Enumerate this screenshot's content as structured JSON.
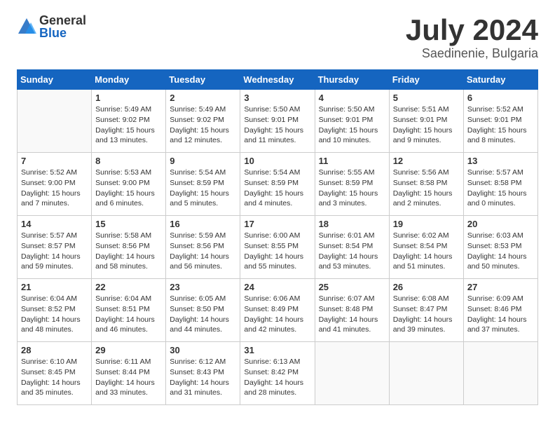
{
  "header": {
    "logo_general": "General",
    "logo_blue": "Blue",
    "month_year": "July 2024",
    "location": "Saedinenie, Bulgaria"
  },
  "days_of_week": [
    "Sunday",
    "Monday",
    "Tuesday",
    "Wednesday",
    "Thursday",
    "Friday",
    "Saturday"
  ],
  "weeks": [
    [
      {
        "day": "",
        "empty": true
      },
      {
        "day": "1",
        "sunrise": "5:49 AM",
        "sunset": "9:02 PM",
        "daylight": "15 hours and 13 minutes."
      },
      {
        "day": "2",
        "sunrise": "5:49 AM",
        "sunset": "9:02 PM",
        "daylight": "15 hours and 12 minutes."
      },
      {
        "day": "3",
        "sunrise": "5:50 AM",
        "sunset": "9:01 PM",
        "daylight": "15 hours and 11 minutes."
      },
      {
        "day": "4",
        "sunrise": "5:50 AM",
        "sunset": "9:01 PM",
        "daylight": "15 hours and 10 minutes."
      },
      {
        "day": "5",
        "sunrise": "5:51 AM",
        "sunset": "9:01 PM",
        "daylight": "15 hours and 9 minutes."
      },
      {
        "day": "6",
        "sunrise": "5:52 AM",
        "sunset": "9:01 PM",
        "daylight": "15 hours and 8 minutes."
      }
    ],
    [
      {
        "day": "7",
        "sunrise": "5:52 AM",
        "sunset": "9:00 PM",
        "daylight": "15 hours and 7 minutes."
      },
      {
        "day": "8",
        "sunrise": "5:53 AM",
        "sunset": "9:00 PM",
        "daylight": "15 hours and 6 minutes."
      },
      {
        "day": "9",
        "sunrise": "5:54 AM",
        "sunset": "8:59 PM",
        "daylight": "15 hours and 5 minutes."
      },
      {
        "day": "10",
        "sunrise": "5:54 AM",
        "sunset": "8:59 PM",
        "daylight": "15 hours and 4 minutes."
      },
      {
        "day": "11",
        "sunrise": "5:55 AM",
        "sunset": "8:59 PM",
        "daylight": "15 hours and 3 minutes."
      },
      {
        "day": "12",
        "sunrise": "5:56 AM",
        "sunset": "8:58 PM",
        "daylight": "15 hours and 2 minutes."
      },
      {
        "day": "13",
        "sunrise": "5:57 AM",
        "sunset": "8:58 PM",
        "daylight": "15 hours and 0 minutes."
      }
    ],
    [
      {
        "day": "14",
        "sunrise": "5:57 AM",
        "sunset": "8:57 PM",
        "daylight": "14 hours and 59 minutes."
      },
      {
        "day": "15",
        "sunrise": "5:58 AM",
        "sunset": "8:56 PM",
        "daylight": "14 hours and 58 minutes."
      },
      {
        "day": "16",
        "sunrise": "5:59 AM",
        "sunset": "8:56 PM",
        "daylight": "14 hours and 56 minutes."
      },
      {
        "day": "17",
        "sunrise": "6:00 AM",
        "sunset": "8:55 PM",
        "daylight": "14 hours and 55 minutes."
      },
      {
        "day": "18",
        "sunrise": "6:01 AM",
        "sunset": "8:54 PM",
        "daylight": "14 hours and 53 minutes."
      },
      {
        "day": "19",
        "sunrise": "6:02 AM",
        "sunset": "8:54 PM",
        "daylight": "14 hours and 51 minutes."
      },
      {
        "day": "20",
        "sunrise": "6:03 AM",
        "sunset": "8:53 PM",
        "daylight": "14 hours and 50 minutes."
      }
    ],
    [
      {
        "day": "21",
        "sunrise": "6:04 AM",
        "sunset": "8:52 PM",
        "daylight": "14 hours and 48 minutes."
      },
      {
        "day": "22",
        "sunrise": "6:04 AM",
        "sunset": "8:51 PM",
        "daylight": "14 hours and 46 minutes."
      },
      {
        "day": "23",
        "sunrise": "6:05 AM",
        "sunset": "8:50 PM",
        "daylight": "14 hours and 44 minutes."
      },
      {
        "day": "24",
        "sunrise": "6:06 AM",
        "sunset": "8:49 PM",
        "daylight": "14 hours and 42 minutes."
      },
      {
        "day": "25",
        "sunrise": "6:07 AM",
        "sunset": "8:48 PM",
        "daylight": "14 hours and 41 minutes."
      },
      {
        "day": "26",
        "sunrise": "6:08 AM",
        "sunset": "8:47 PM",
        "daylight": "14 hours and 39 minutes."
      },
      {
        "day": "27",
        "sunrise": "6:09 AM",
        "sunset": "8:46 PM",
        "daylight": "14 hours and 37 minutes."
      }
    ],
    [
      {
        "day": "28",
        "sunrise": "6:10 AM",
        "sunset": "8:45 PM",
        "daylight": "14 hours and 35 minutes."
      },
      {
        "day": "29",
        "sunrise": "6:11 AM",
        "sunset": "8:44 PM",
        "daylight": "14 hours and 33 minutes."
      },
      {
        "day": "30",
        "sunrise": "6:12 AM",
        "sunset": "8:43 PM",
        "daylight": "14 hours and 31 minutes."
      },
      {
        "day": "31",
        "sunrise": "6:13 AM",
        "sunset": "8:42 PM",
        "daylight": "14 hours and 28 minutes."
      },
      {
        "day": "",
        "empty": true
      },
      {
        "day": "",
        "empty": true
      },
      {
        "day": "",
        "empty": true
      }
    ]
  ],
  "labels": {
    "sunrise": "Sunrise: ",
    "sunset": "Sunset: ",
    "daylight": "Daylight: "
  }
}
